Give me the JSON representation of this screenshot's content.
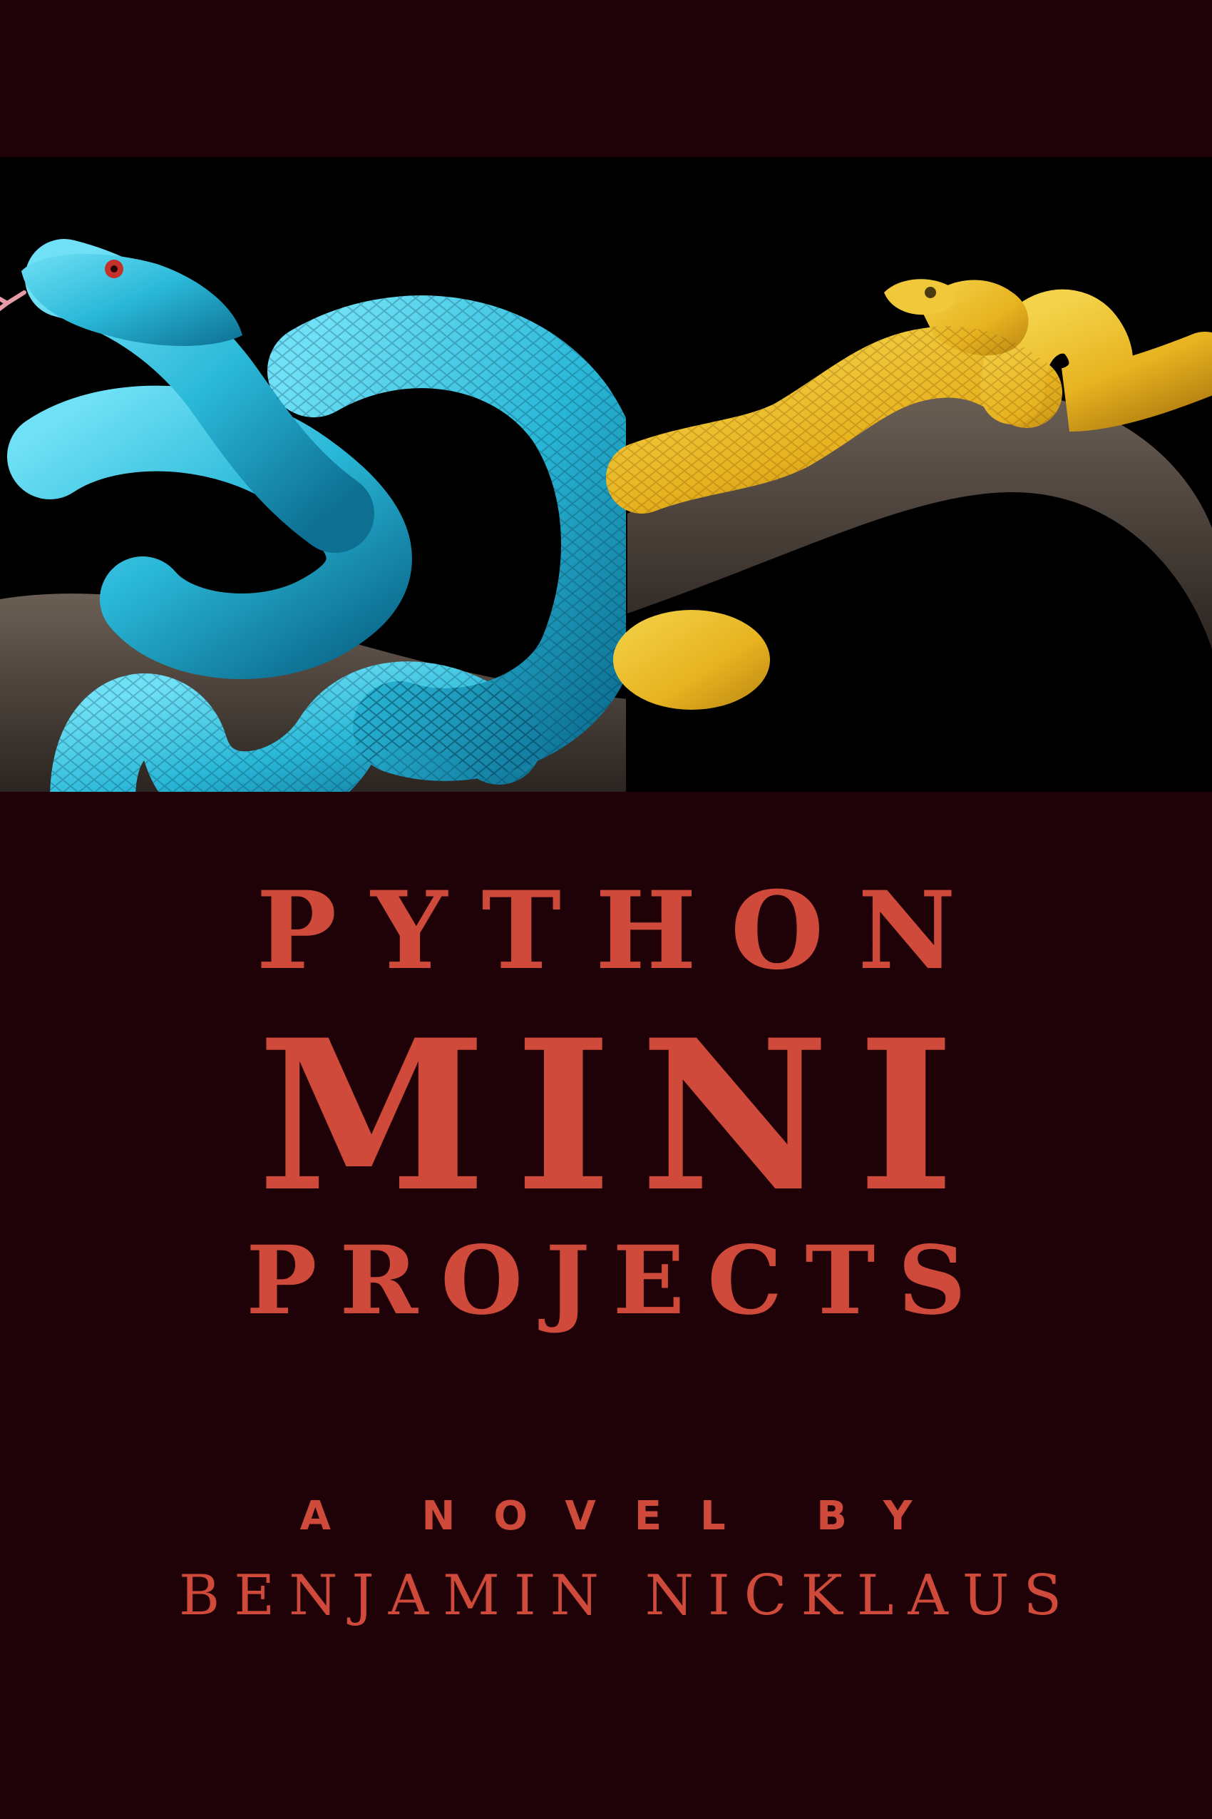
{
  "cover": {
    "title_line1": "PYTHON",
    "title_line2": "MINI",
    "title_line3": "PROJECTS",
    "byline": "A NOVEL BY",
    "author": "BENJAMIN NICKLAUS"
  },
  "colors": {
    "background": "#1f0207",
    "photo_background": "#000000",
    "text_accent": "#d04a3c",
    "blue_snake": "#2ab8d8",
    "yellow_snake": "#e7b320",
    "branch": "#4a4038"
  },
  "illustrations": {
    "left": "blue-viper-snake",
    "right": "yellow-eyelash-viper-snake"
  }
}
